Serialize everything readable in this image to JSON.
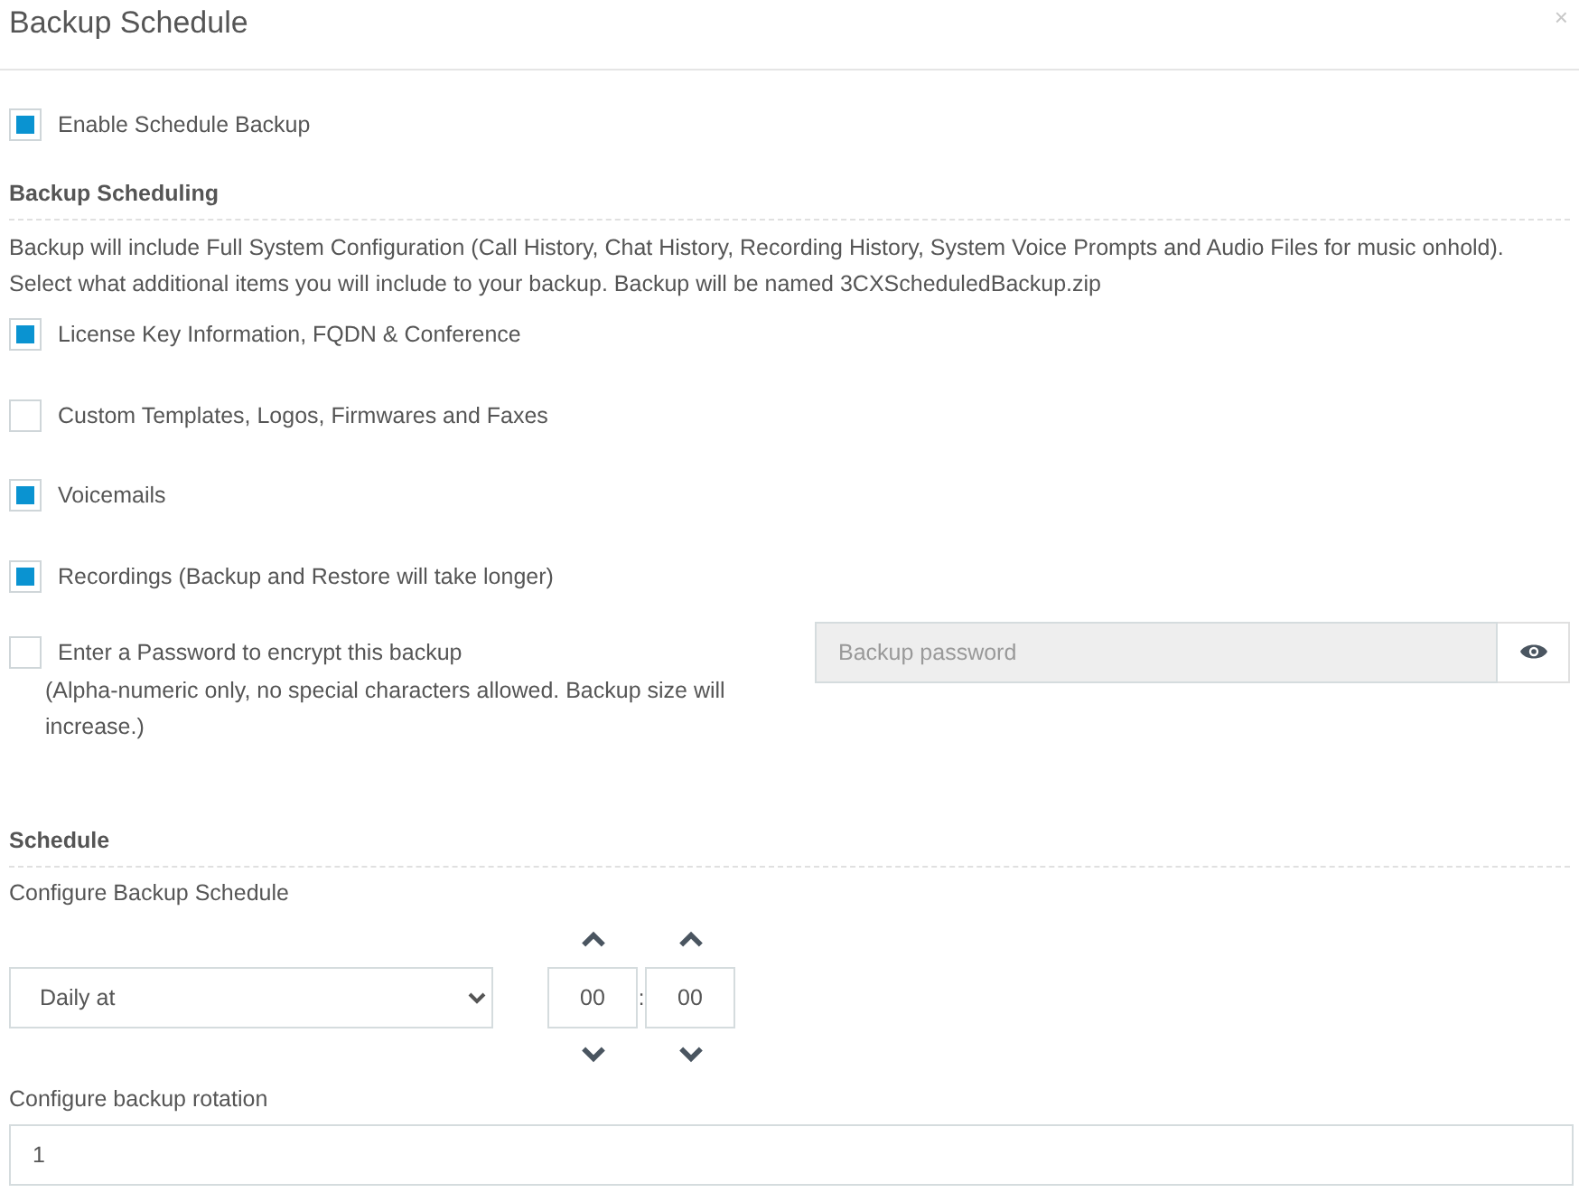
{
  "dialog": {
    "title": "Backup Schedule",
    "close": "×"
  },
  "enable": {
    "label": "Enable Schedule Backup",
    "checked": true
  },
  "backup_scheduling": {
    "heading": "Backup Scheduling",
    "description": [
      "Backup will include Full System Configuration (Call History, Chat History, Recording History, System Voice Prompts and Audio Files for music onhold).",
      "Select what additional items you will include to your backup. Backup will be named 3CXScheduledBackup.zip"
    ],
    "options": [
      {
        "label": "License Key Information, FQDN & Conference",
        "checked": true
      },
      {
        "label": "Custom Templates, Logos, Firmwares and Faxes",
        "checked": false
      },
      {
        "label": "Voicemails",
        "checked": true
      },
      {
        "label": "Recordings (Backup and Restore will take longer)",
        "checked": true
      }
    ],
    "password": {
      "label": "Enter a Password to encrypt this backup",
      "note": "(Alpha-numeric only, no special characters allowed. Backup size will increase.)",
      "checked": false,
      "placeholder": "Backup password"
    }
  },
  "schedule": {
    "heading": "Schedule",
    "label": "Configure Backup Schedule",
    "frequency": "Daily at",
    "hour": "00",
    "separator": ":",
    "minute": "00",
    "rotation_label": "Configure backup rotation",
    "rotation": "1"
  }
}
